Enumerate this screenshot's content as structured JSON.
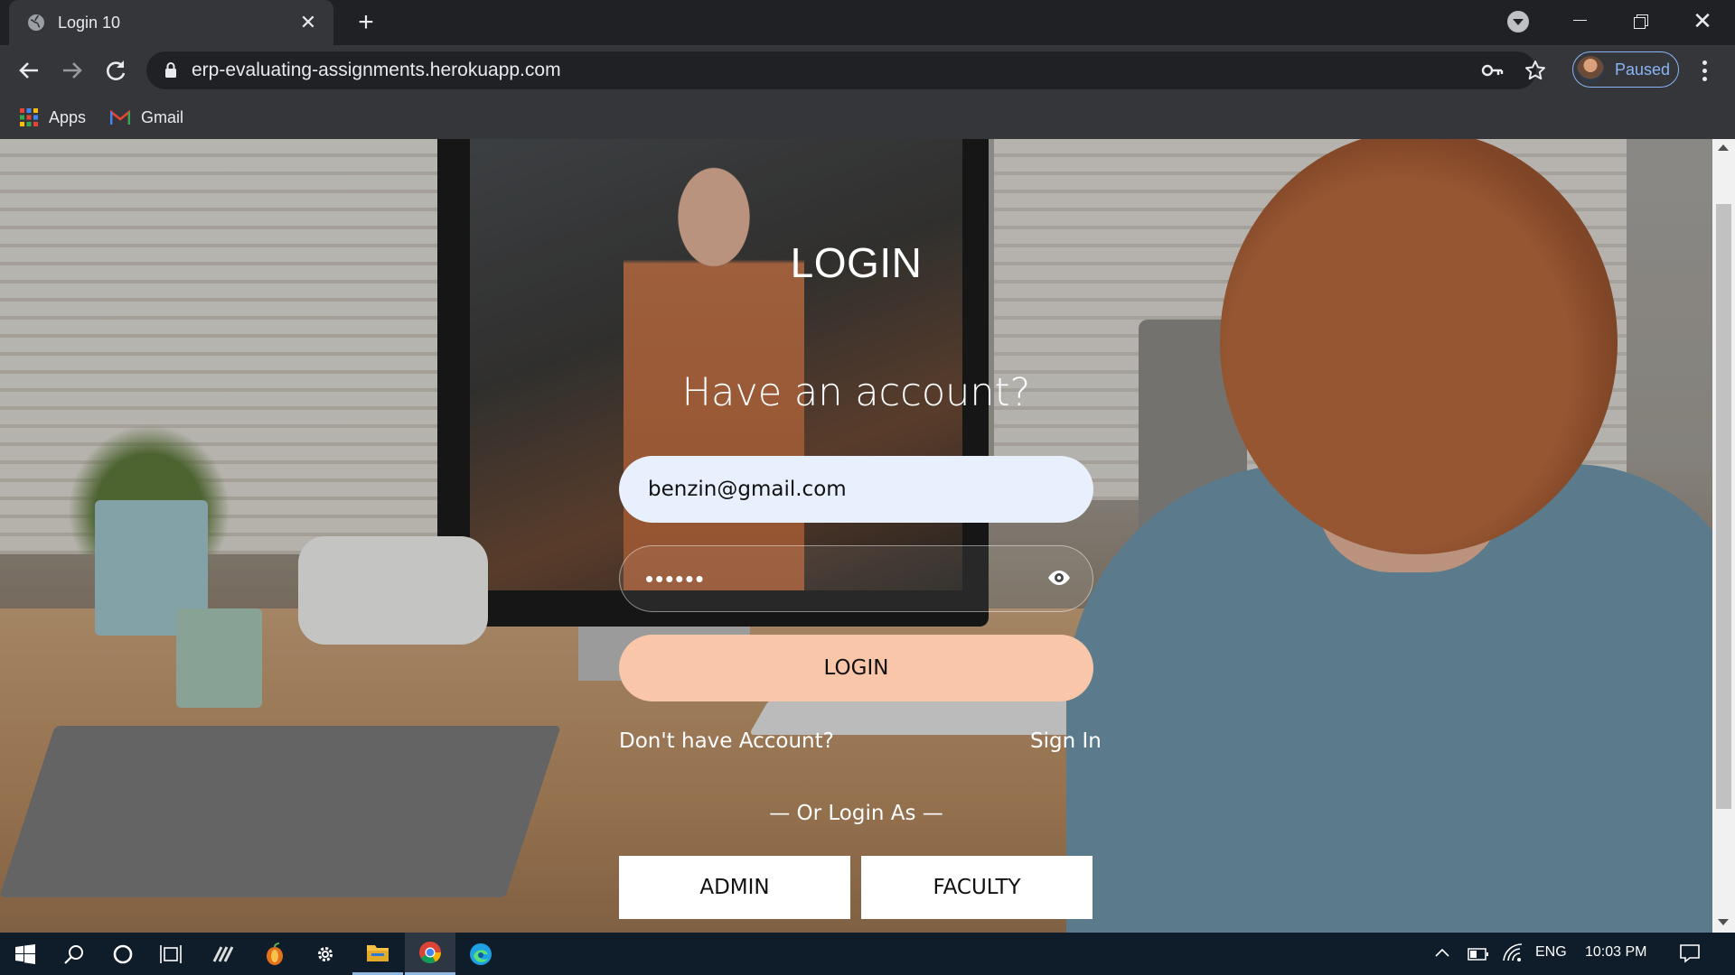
{
  "browser": {
    "tab_title": "Login 10",
    "tab_close": "✕",
    "new_tab": "+",
    "url": "erp-evaluating-assignments.herokuapp.com",
    "profile_label": "Paused",
    "bookmarks": [
      {
        "label": "Apps",
        "icon": "apps-grid-icon"
      },
      {
        "label": "Gmail",
        "icon": "gmail-icon"
      }
    ]
  },
  "page": {
    "heading": "LOGIN",
    "subtitle": "Have an account?",
    "email_value": "benzin@gmail.com",
    "password_value": "••••••",
    "login_button": "LOGIN",
    "no_account_text": "Don't have Account?",
    "sign_in_link": "Sign In",
    "or_login_as": "— Or Login As —",
    "role_buttons": [
      "ADMIN",
      "FACULTY"
    ]
  },
  "taskbar": {
    "language": "ENG",
    "time": "10:03 PM"
  },
  "colors": {
    "login_button_bg": "#f9c6a9",
    "email_field_bg": "#e8f0fe",
    "profile_accent": "#8ab4f8",
    "taskbar_bg": "#0f1c2a"
  }
}
